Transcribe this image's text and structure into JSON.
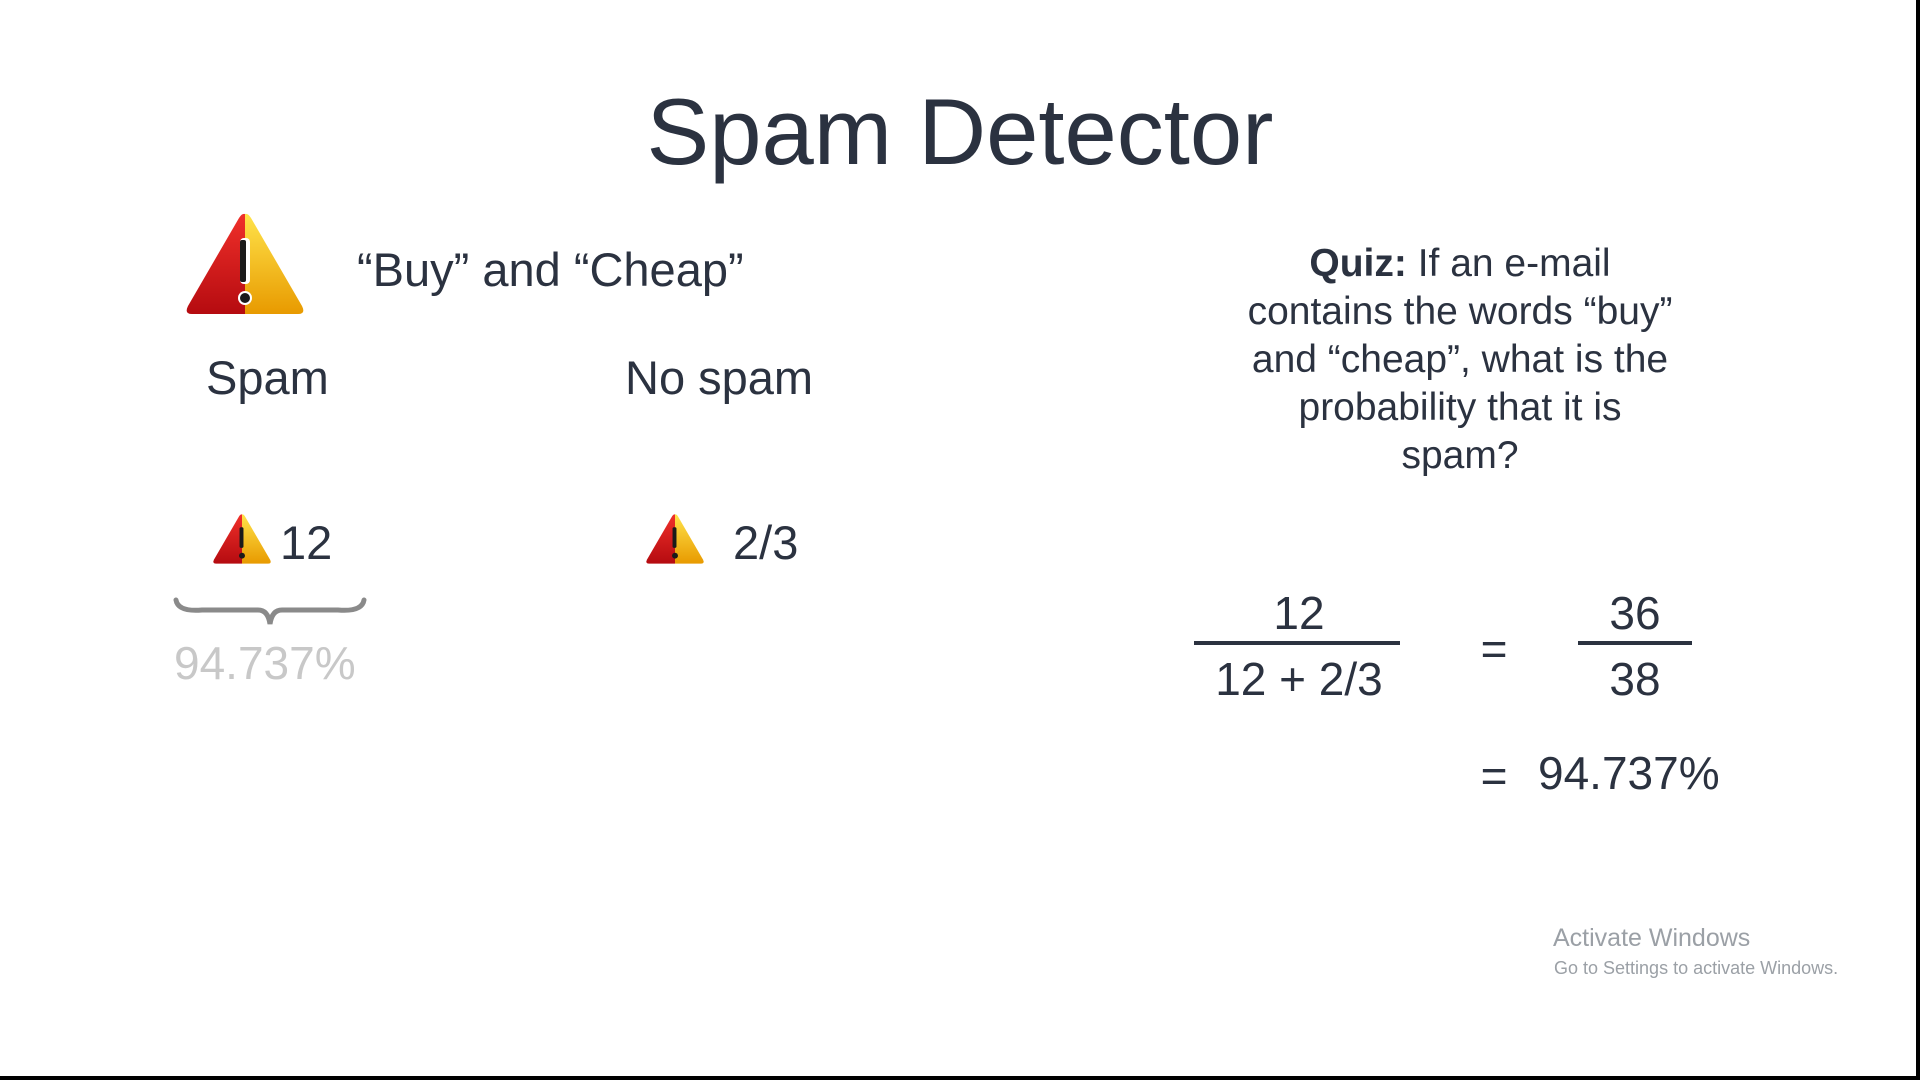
{
  "slide": {
    "title": "Spam Detector",
    "phrase": "“Buy” and “Cheap”",
    "columns": {
      "spam_label": "Spam",
      "no_spam_label": "No spam"
    },
    "counts": {
      "spam": "12",
      "no_spam": "2/3"
    },
    "faded_result": "94.737%",
    "quiz": {
      "prefix": "Quiz:",
      "line1": " If an e-mail",
      "line2": "contains the words “buy”",
      "line3": "and “cheap”, what is the",
      "line4": "probability that it is",
      "line5": "spam?"
    },
    "calculation": {
      "numerator": "12",
      "denominator": "12 + 2/3",
      "equals": "=",
      "numerator2": "36",
      "denominator2": "38",
      "result": "94.737%"
    }
  },
  "watermark": {
    "title": "Activate Windows",
    "subtitle": "Go to Settings to activate Windows."
  },
  "colors": {
    "text": "#2b3240",
    "warning_red": "#d4141a",
    "warning_yellow": "#f5b800",
    "faded": "#c8c8c8"
  },
  "icons": {
    "warning": "warning-triangle-icon",
    "brace": "curly-brace-icon"
  }
}
